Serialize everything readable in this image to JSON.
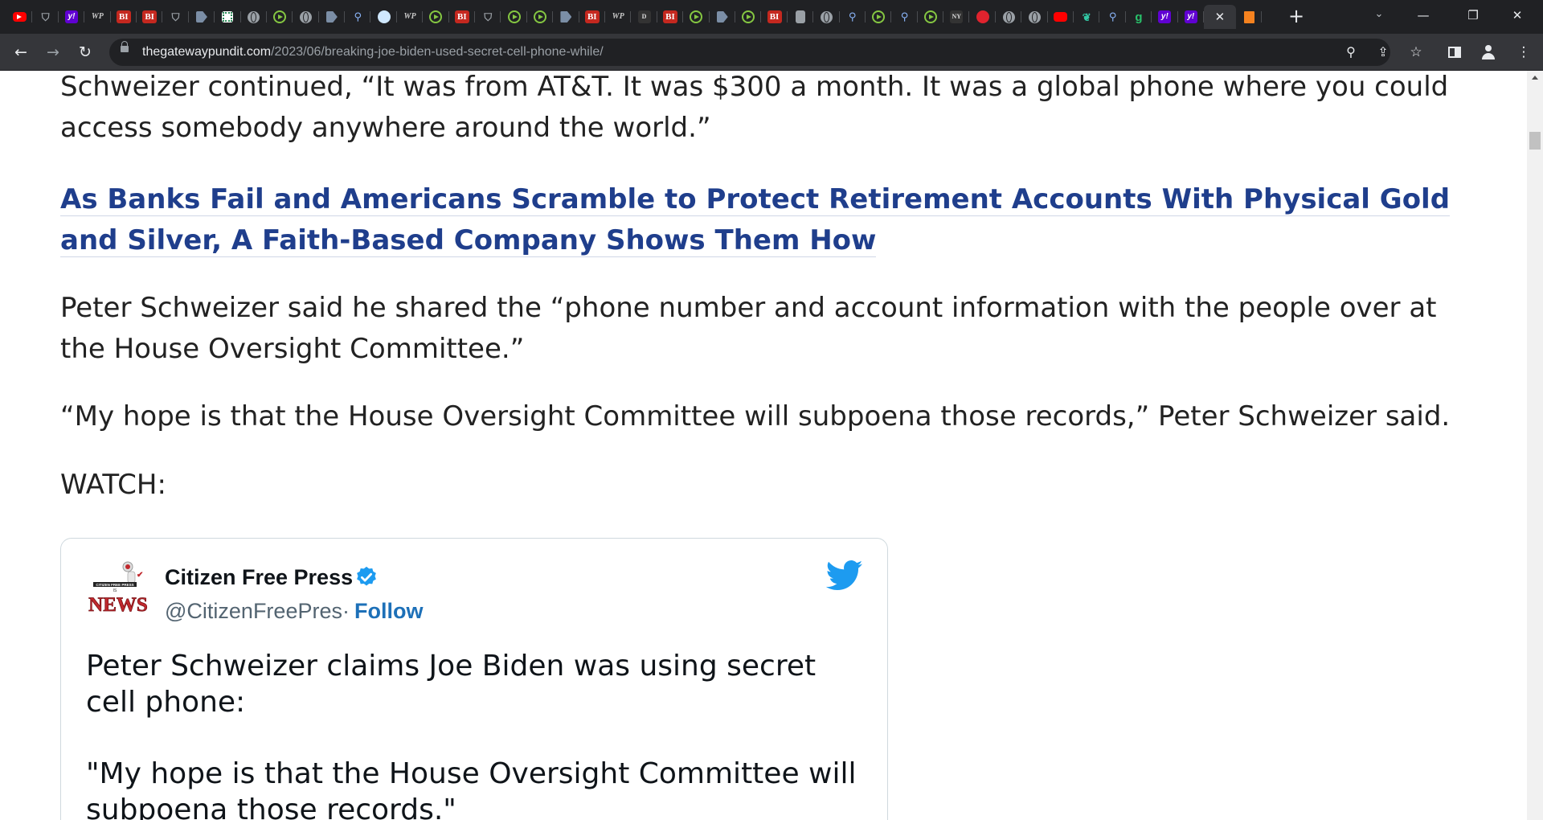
{
  "browser": {
    "tabs": [
      {
        "icon": "youtube-icon",
        "kind": "yt",
        "glyph": ""
      },
      {
        "icon": "shield-icon",
        "kind": "shield",
        "glyph": "⛉"
      },
      {
        "icon": "yahoo-icon",
        "kind": "yh",
        "glyph": "y!"
      },
      {
        "icon": "washington-post-icon",
        "kind": "wp",
        "glyph": "WP"
      },
      {
        "icon": "business-insider-icon",
        "kind": "bi",
        "glyph": "BI"
      },
      {
        "icon": "business-insider-icon",
        "kind": "bi",
        "glyph": "BI"
      },
      {
        "icon": "shield-icon",
        "kind": "shield",
        "glyph": "⛉"
      },
      {
        "icon": "dg-icon",
        "kind": "dg",
        "glyph": ""
      },
      {
        "icon": "grid-icon",
        "kind": "grid",
        "glyph": ""
      },
      {
        "icon": "globe-icon",
        "kind": "globe",
        "glyph": ""
      },
      {
        "icon": "rumble-icon",
        "kind": "rumble",
        "glyph": ""
      },
      {
        "icon": "globe-icon",
        "kind": "globe",
        "glyph": ""
      },
      {
        "icon": "dg-icon",
        "kind": "dg",
        "glyph": ""
      },
      {
        "icon": "search-icon",
        "kind": "search",
        "glyph": "⚲"
      },
      {
        "icon": "tree-icon",
        "kind": "tree",
        "glyph": ""
      },
      {
        "icon": "washington-post-icon",
        "kind": "wp",
        "glyph": "WP"
      },
      {
        "icon": "rumble-icon",
        "kind": "rumble",
        "glyph": ""
      },
      {
        "icon": "business-insider-icon",
        "kind": "bi",
        "glyph": "BI"
      },
      {
        "icon": "shield-icon",
        "kind": "shield",
        "glyph": "⛉"
      },
      {
        "icon": "rumble-icon",
        "kind": "rumble",
        "glyph": ""
      },
      {
        "icon": "rumble-icon",
        "kind": "rumble",
        "glyph": ""
      },
      {
        "icon": "dg-icon",
        "kind": "dg",
        "glyph": ""
      },
      {
        "icon": "business-insider-icon",
        "kind": "bi",
        "glyph": "BI"
      },
      {
        "icon": "washington-post-icon",
        "kind": "wp",
        "glyph": "WP"
      },
      {
        "icon": "dark-icon",
        "kind": "dark",
        "glyph": "D"
      },
      {
        "icon": "business-insider-icon",
        "kind": "bi",
        "glyph": "BI"
      },
      {
        "icon": "rumble-icon",
        "kind": "rumble",
        "glyph": ""
      },
      {
        "icon": "dg-icon",
        "kind": "dg",
        "glyph": ""
      },
      {
        "icon": "rumble-icon",
        "kind": "rumble",
        "glyph": ""
      },
      {
        "icon": "business-insider-icon",
        "kind": "bi",
        "glyph": "BI"
      },
      {
        "icon": "microphone-icon",
        "kind": "mic",
        "glyph": ""
      },
      {
        "icon": "globe-icon",
        "kind": "globe",
        "glyph": ""
      },
      {
        "icon": "search-icon",
        "kind": "search",
        "glyph": "⚲"
      },
      {
        "icon": "rumble-icon",
        "kind": "rumble",
        "glyph": ""
      },
      {
        "icon": "search-icon",
        "kind": "search",
        "glyph": "⚲"
      },
      {
        "icon": "rumble-icon",
        "kind": "rumble",
        "glyph": ""
      },
      {
        "icon": "news-icon",
        "kind": "dark",
        "glyph": "NY"
      },
      {
        "icon": "red-pin-icon",
        "kind": "red",
        "glyph": ""
      },
      {
        "icon": "globe-icon",
        "kind": "globe",
        "glyph": ""
      },
      {
        "icon": "globe-icon",
        "kind": "globe",
        "glyph": ""
      },
      {
        "icon": "youtube-icon",
        "kind": "ytr",
        "glyph": ""
      },
      {
        "icon": "leaf-icon",
        "kind": "leaf",
        "glyph": "❦"
      },
      {
        "icon": "search-icon",
        "kind": "search",
        "glyph": "⚲"
      },
      {
        "icon": "g-icon",
        "kind": "g",
        "glyph": "g"
      },
      {
        "icon": "yahoo-icon",
        "kind": "yh",
        "glyph": "y!"
      },
      {
        "icon": "yahoo-icon",
        "kind": "yh",
        "glyph": "y!"
      },
      {
        "icon": "close-icon",
        "kind": "active",
        "glyph": "✕"
      },
      {
        "icon": "bookmark-icon",
        "kind": "book",
        "glyph": ""
      }
    ],
    "new_tab_glyph": "+",
    "url_domain": "thegatewaypundit.com",
    "url_path": "/2023/06/breaking-joe-biden-used-secret-cell-phone-while/"
  },
  "article": {
    "paragraph_1": "Schweizer continued, “It was from AT&T. It was $300 a month. It was a global phone where you could access somebody anywhere around the world.”",
    "promo_link": "As Banks Fail and Americans Scramble to Protect Retirement Accounts With Physical Gold and Silver, A Faith-Based Company Shows Them How",
    "paragraph_2": "Peter Schweizer said he shared the “phone number and account information with the people over at the House Oversight Committee.”",
    "paragraph_3": "“My hope is that the House Oversight Committee will subpoena those records,” Peter Schweizer said.",
    "paragraph_4": "WATCH:"
  },
  "tweet": {
    "author_name": "Citizen Free Press",
    "handle": "@CitizenFreePres",
    "separator": "·",
    "follow_label": "Follow",
    "text_line_1": "Peter Schweizer claims Joe Biden was using secret cell phone:",
    "text_line_2": "\"My hope is that the House Oversight Committee will subpoena those records.\"",
    "avatar_text": "NEWS",
    "avatar_small_text": "CITIZEN FREE PRESS",
    "avatar_tag": "IS"
  },
  "colors": {
    "link": "#1f3e8c",
    "twitter_blue": "#1d9bf0",
    "follow": "#1d70b8",
    "tab_bar": "#202124",
    "toolbar": "#35363a"
  }
}
